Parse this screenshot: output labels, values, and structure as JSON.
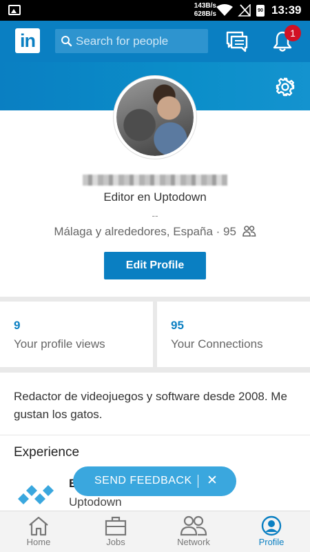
{
  "status_bar": {
    "speed_up": "143B/s",
    "speed_down": "628B/s",
    "battery": "90",
    "time": "13:39"
  },
  "header": {
    "logo_text": "in",
    "search_placeholder": "Search for people",
    "notification_count": "1"
  },
  "profile": {
    "headline": "Editor en Uptodown",
    "separator": "--",
    "location": "Málaga y alrededores, España",
    "connections_count": "95",
    "edit_button_label": "Edit Profile"
  },
  "stats": [
    {
      "value": "9",
      "label": "Your profile views"
    },
    {
      "value": "95",
      "label": "Your Connections"
    }
  ],
  "summary": {
    "text": "Redactor de videojuegos y software desde 2008. Me gustan los gatos."
  },
  "experience": {
    "title": "Experience",
    "role": "E",
    "company": "Uptodown"
  },
  "feedback": {
    "label": "SEND FEEDBACK",
    "close": "✕"
  },
  "bottom_nav": [
    {
      "label": "Home",
      "icon": "home-icon"
    },
    {
      "label": "Jobs",
      "icon": "briefcase-icon"
    },
    {
      "label": "Network",
      "icon": "network-icon"
    },
    {
      "label": "Profile",
      "icon": "profile-icon",
      "active": true
    }
  ],
  "colors": {
    "brand": "#0a7fc2",
    "badge": "#d11124",
    "feedback": "#3aa7de"
  }
}
